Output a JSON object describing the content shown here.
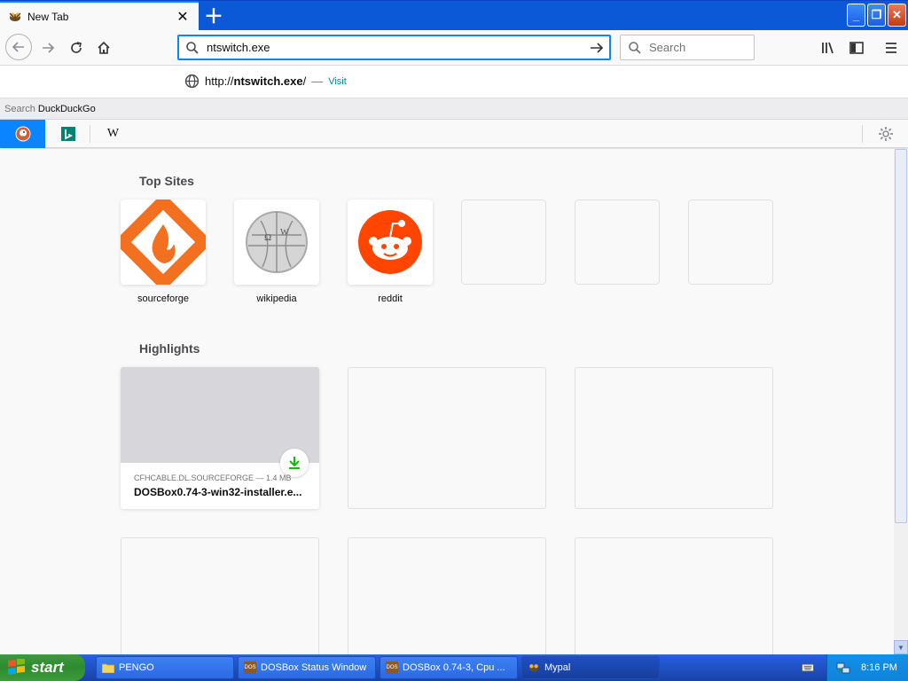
{
  "browser": {
    "tab": {
      "title": "New Tab"
    },
    "url": "ntswitch.exe",
    "search_placeholder": "Search",
    "suggestion": {
      "prefix": "http://",
      "host": "ntswitch.exe",
      "suffix": "/",
      "separator": "—",
      "action": "Visit"
    },
    "search_with": {
      "label": "Search",
      "engine": "DuckDuckGo"
    },
    "engines": [
      "duckduckgo",
      "bing",
      "wikipedia"
    ]
  },
  "newtab": {
    "top_sites_title": "Top Sites",
    "top_sites": [
      {
        "label": "sourceforge"
      },
      {
        "label": "wikipedia"
      },
      {
        "label": "reddit"
      }
    ],
    "highlights_title": "Highlights",
    "highlight": {
      "meta": "CFHCABLE.DL.SOURCEFORGE — 1.4 MB",
      "name": "DOSBox0.74-3-win32-installer.e..."
    }
  },
  "taskbar": {
    "start": "start",
    "tasks": [
      {
        "label": "PENGO"
      },
      {
        "label": "DOSBox Status Window"
      },
      {
        "label": "DOSBox 0.74-3, Cpu ..."
      },
      {
        "label": "Mypal"
      }
    ],
    "clock": "8:16 PM"
  },
  "colors": {
    "accent": "#0a84ff",
    "sourceforge": "#f37021",
    "reddit": "#ff4500",
    "download": "#12bc00"
  }
}
